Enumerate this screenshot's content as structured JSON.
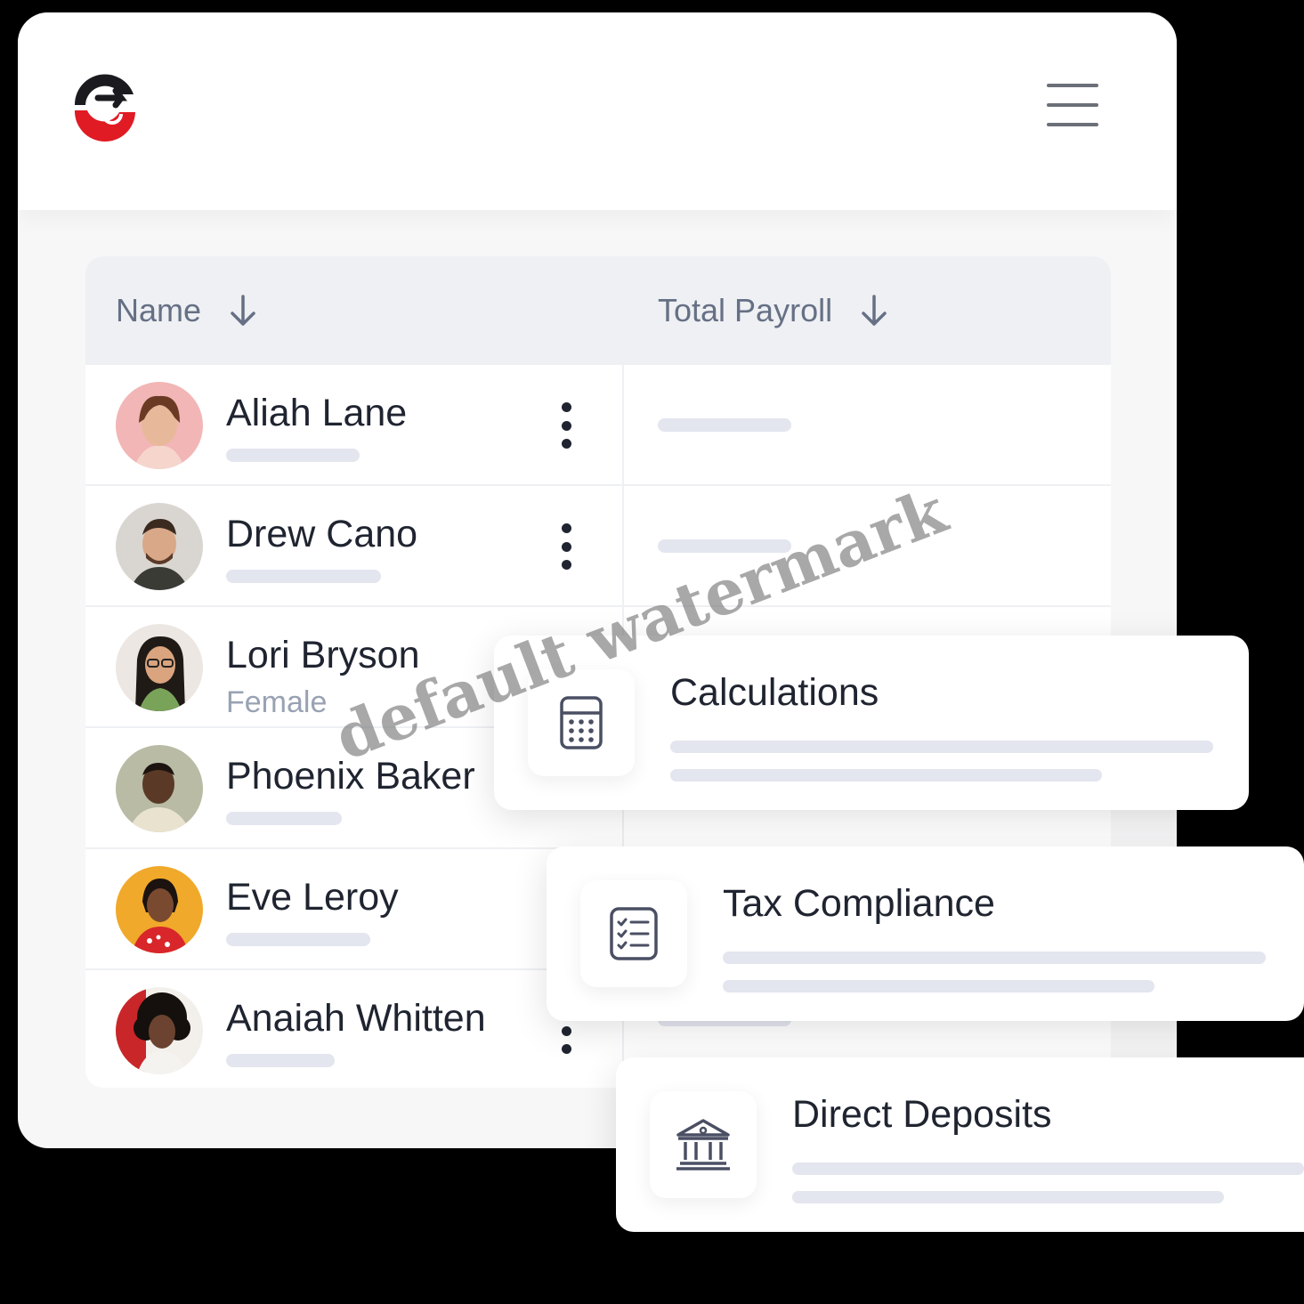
{
  "header": {
    "logo_icon": "brand-logo-icon",
    "menu_icon": "hamburger-menu-icon"
  },
  "table": {
    "columns": [
      {
        "label": "Name",
        "sort_icon": "arrow-down-icon"
      },
      {
        "label": "Total Payroll",
        "sort_icon": "arrow-down-icon"
      }
    ],
    "rows": [
      {
        "name": "Aliah Lane",
        "subtitle": "",
        "avatar_color": "#f2b6b6"
      },
      {
        "name": "Drew Cano",
        "subtitle": "",
        "avatar_color": "#d9d6d1"
      },
      {
        "name": "Lori Bryson",
        "subtitle": "Female",
        "avatar_color": "#ece7e2"
      },
      {
        "name": "Phoenix Baker",
        "subtitle": "",
        "avatar_color": "#b9bba4"
      },
      {
        "name": "Eve Leroy",
        "subtitle": "",
        "avatar_color": "#f0a92a"
      },
      {
        "name": "Anaiah Whitten",
        "subtitle": "",
        "avatar_color": "#c9262a"
      }
    ]
  },
  "cards": [
    {
      "title": "Calculations",
      "icon": "calculator-icon"
    },
    {
      "title": "Tax Compliance",
      "icon": "checklist-icon"
    },
    {
      "title": "Direct Deposits",
      "icon": "bank-icon"
    }
  ],
  "watermark": "default watermark",
  "colors": {
    "brand_red": "#e01b24",
    "brand_dark": "#1b1b1f",
    "placeholder": "#e3e5ef",
    "header_bg": "#eef0f3"
  }
}
